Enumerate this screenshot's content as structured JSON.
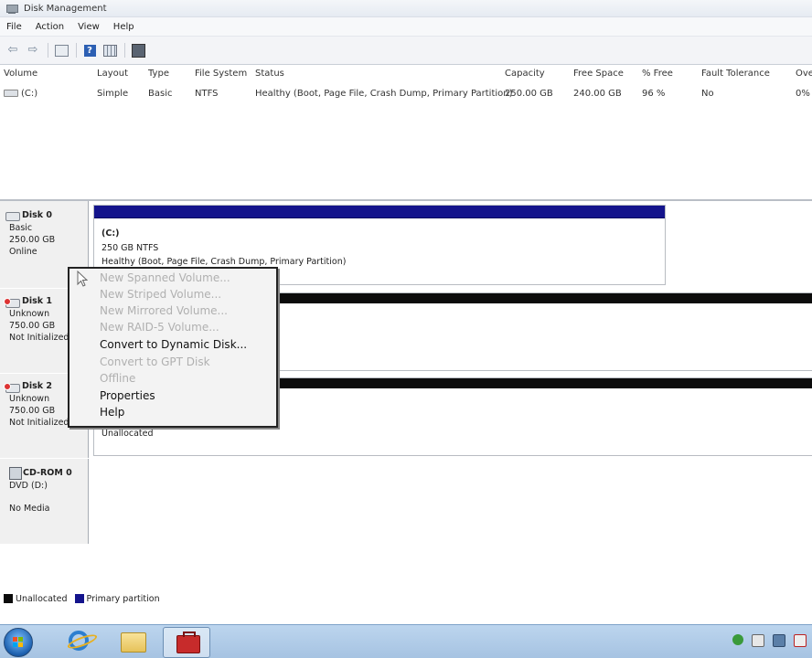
{
  "window": {
    "title": "Disk Management"
  },
  "menu": [
    "File",
    "Action",
    "View",
    "Help"
  ],
  "toolbar": {
    "icons": [
      "back-arrow-icon",
      "forward-arrow-icon",
      "console-tree-icon",
      "help-icon",
      "properties-icon",
      "disk-refresh-icon"
    ]
  },
  "volume_list": {
    "headers": [
      "Volume",
      "Layout",
      "Type",
      "File System",
      "Status",
      "Capacity",
      "Free Space",
      "% Free",
      "Fault Tolerance",
      "Ove"
    ],
    "rows": [
      {
        "volume": "(C:)",
        "layout": "Simple",
        "type": "Basic",
        "file_system": "NTFS",
        "status": "Healthy (Boot, Page File, Crash Dump, Primary Partition)",
        "capacity": "250.00 GB",
        "free_space": "240.00 GB",
        "pct_free": "96 %",
        "fault_tolerance": "No",
        "overhead": "0%"
      }
    ]
  },
  "disks": [
    {
      "name": "Disk 0",
      "type": "Basic",
      "size": "250.00 GB",
      "state": "Online",
      "partition": {
        "label": "(C:)",
        "size_fs": "250 GB NTFS",
        "status": "Healthy (Boot, Page File, Crash Dump, Primary Partition)"
      }
    },
    {
      "name": "Disk 1",
      "type": "Unknown",
      "size": "750.00 GB",
      "state": "Not Initialized"
    },
    {
      "name": "Disk 2",
      "type": "Unknown",
      "size": "750.00 GB",
      "state": "Not Initialized",
      "partition_status": "Unallocated"
    },
    {
      "name": "CD-ROM 0",
      "type": "DVD (D:)",
      "state": "No Media"
    }
  ],
  "context_menu": {
    "items": [
      {
        "label": "New Spanned Volume...",
        "enabled": false
      },
      {
        "label": "New Striped Volume...",
        "enabled": false
      },
      {
        "label": "New Mirrored Volume...",
        "enabled": false
      },
      {
        "label": "New RAID-5 Volume...",
        "enabled": false
      },
      {
        "label": "Convert to Dynamic Disk...",
        "enabled": true
      },
      {
        "label": "Convert to GPT Disk",
        "enabled": false
      },
      {
        "label": "Offline",
        "enabled": false
      },
      {
        "label": "Properties",
        "enabled": true
      },
      {
        "label": "Help",
        "enabled": true
      }
    ]
  },
  "legend": [
    {
      "label": "Unallocated",
      "color": "#0c0c0c"
    },
    {
      "label": "Primary partition",
      "color": "#14148c"
    }
  ],
  "taskbar": {
    "icons": [
      "start-button-icon",
      "internet-explorer-icon",
      "windows-explorer-icon",
      "server-manager-icon"
    ],
    "tray_icons": [
      "security-tray-icon",
      "flag-tray-icon",
      "network-tray-icon",
      "volume-tray-icon"
    ]
  },
  "colors": {
    "primary_partition": "#14148c",
    "unallocated": "#0c0c0c",
    "taskbar": "#a6c3e2"
  }
}
